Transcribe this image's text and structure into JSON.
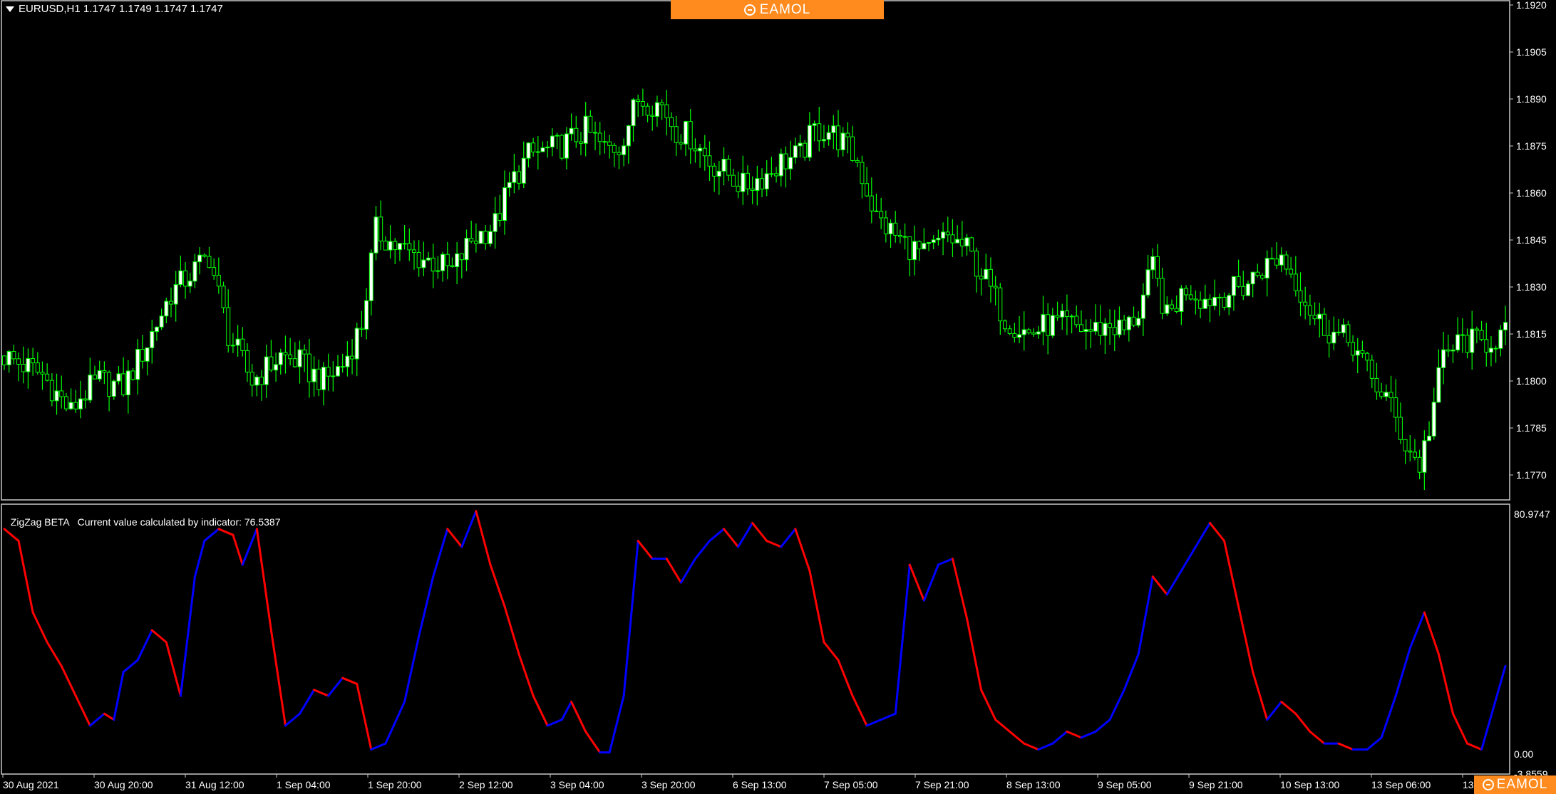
{
  "symbol": {
    "menu_icon": "triangle-down-icon",
    "label": "EURUSD,H1  1.1747 1.1749 1.1747 1.1747"
  },
  "brand": {
    "logo_icon": "eamol-logo-icon",
    "name": "EAMOL"
  },
  "colors": {
    "background": "#000000",
    "grid_border": "#c8c8c8",
    "candle": "#00ff00",
    "candle_body_up": "#ffffff",
    "zigzag_up": "#0000ff",
    "zigzag_down": "#ff0000",
    "brand": "#ff8a1e"
  },
  "price_axis": {
    "labels": [
      "1.1920",
      "1.1905",
      "1.1890",
      "1.1875",
      "1.1860",
      "1.1845",
      "1.1830",
      "1.1815",
      "1.1800",
      "1.1785",
      "1.1770"
    ]
  },
  "indicator": {
    "label": "ZigZag BETA   Current value calculated by indicator: 76.5387",
    "axis_labels": {
      "max": "80.9747",
      "zero": "0.00",
      "min": "-3.8559"
    }
  },
  "time_axis": {
    "labels": [
      "30 Aug 2021",
      "30 Aug 20:00",
      "31 Aug 12:00",
      "1 Sep 04:00",
      "1 Sep 20:00",
      "2 Sep 12:00",
      "3 Sep 04:00",
      "3 Sep 20:00",
      "6 Sep 13:00",
      "7 Sep 05:00",
      "7 Sep 21:00",
      "8 Sep 13:00",
      "9 Sep 05:00",
      "9 Sep 21:00",
      "10 Sep 13:00",
      "13 Sep 06:00",
      "13 Sep 22:00"
    ]
  },
  "chart_data": {
    "type": "candlestick",
    "symbol": "EURUSD",
    "timeframe": "H1",
    "ylim": [
      1.1765,
      1.192
    ],
    "close_path": [
      [
        0,
        1.1808
      ],
      [
        8,
        1.1802
      ],
      [
        14,
        1.179
      ],
      [
        16,
        1.1795
      ],
      [
        20,
        1.18
      ],
      [
        25,
        1.1798
      ],
      [
        30,
        1.1812
      ],
      [
        35,
        1.1828
      ],
      [
        43,
        1.184
      ],
      [
        47,
        1.1815
      ],
      [
        52,
        1.18
      ],
      [
        58,
        1.1808
      ],
      [
        62,
        1.1806
      ],
      [
        64,
        1.1803
      ],
      [
        67,
        1.18
      ],
      [
        71,
        1.1805
      ],
      [
        75,
        1.1818
      ],
      [
        78,
        1.1848
      ],
      [
        82,
        1.1843
      ],
      [
        86,
        1.184
      ],
      [
        90,
        1.1838
      ],
      [
        94,
        1.1835
      ],
      [
        98,
        1.1845
      ],
      [
        103,
        1.185
      ],
      [
        106,
        1.1862
      ],
      [
        110,
        1.1872
      ],
      [
        115,
        1.1874
      ],
      [
        118,
        1.1876
      ],
      [
        122,
        1.188
      ],
      [
        126,
        1.1874
      ],
      [
        129,
        1.1875
      ],
      [
        133,
        1.189
      ],
      [
        138,
        1.1888
      ],
      [
        141,
        1.188
      ],
      [
        144,
        1.1878
      ],
      [
        148,
        1.187
      ],
      [
        152,
        1.1866
      ],
      [
        155,
        1.1862
      ],
      [
        160,
        1.1866
      ],
      [
        163,
        1.187
      ],
      [
        167,
        1.1872
      ],
      [
        170,
        1.188
      ],
      [
        173,
        1.188
      ],
      [
        176,
        1.1876
      ],
      [
        179,
        1.187
      ],
      [
        183,
        1.1852
      ],
      [
        188,
        1.1845
      ],
      [
        193,
        1.184
      ],
      [
        198,
        1.1846
      ],
      [
        202,
        1.1842
      ],
      [
        206,
        1.1832
      ],
      [
        210,
        1.182
      ],
      [
        215,
        1.1815
      ],
      [
        219,
        1.1818
      ],
      [
        223,
        1.1818
      ],
      [
        228,
        1.1816
      ],
      [
        232,
        1.1818
      ],
      [
        235,
        1.1816
      ],
      [
        238,
        1.1822
      ],
      [
        241,
        1.1836
      ],
      [
        244,
        1.182
      ],
      [
        248,
        1.183
      ],
      [
        252,
        1.1826
      ],
      [
        256,
        1.1828
      ],
      [
        260,
        1.183
      ],
      [
        264,
        1.1836
      ],
      [
        268,
        1.184
      ],
      [
        271,
        1.1832
      ],
      [
        275,
        1.182
      ],
      [
        279,
        1.1815
      ],
      [
        283,
        1.1812
      ],
      [
        287,
        1.18
      ],
      [
        290,
        1.1795
      ],
      [
        294,
        1.178
      ],
      [
        297,
        1.1773
      ],
      [
        299,
        1.1785
      ],
      [
        302,
        1.1808
      ],
      [
        306,
        1.1813
      ],
      [
        310,
        1.1812
      ],
      [
        315,
        1.1815
      ]
    ],
    "zigzag_path": [
      [
        0,
        76
      ],
      [
        3,
        72
      ],
      [
        6,
        48
      ],
      [
        9,
        38
      ],
      [
        12,
        30
      ],
      [
        15,
        20
      ],
      [
        18,
        10
      ],
      [
        21,
        14
      ],
      [
        23,
        12
      ],
      [
        25,
        28
      ],
      [
        28,
        32
      ],
      [
        31,
        42
      ],
      [
        34,
        38
      ],
      [
        37,
        20
      ],
      [
        40,
        60
      ],
      [
        42,
        72
      ],
      [
        45,
        76
      ],
      [
        48,
        74
      ],
      [
        50,
        64
      ],
      [
        53,
        76
      ],
      [
        56,
        42
      ],
      [
        59,
        10
      ],
      [
        62,
        14
      ],
      [
        65,
        22
      ],
      [
        68,
        20
      ],
      [
        71,
        26
      ],
      [
        74,
        24
      ],
      [
        77,
        2
      ],
      [
        80,
        4
      ],
      [
        84,
        18
      ],
      [
        87,
        40
      ],
      [
        90,
        60
      ],
      [
        93,
        76
      ],
      [
        96,
        70
      ],
      [
        99,
        82
      ],
      [
        102,
        64
      ],
      [
        105,
        50
      ],
      [
        108,
        34
      ],
      [
        111,
        20
      ],
      [
        114,
        10
      ],
      [
        117,
        12
      ],
      [
        119,
        18
      ],
      [
        122,
        8
      ],
      [
        125,
        1
      ],
      [
        127,
        1
      ],
      [
        130,
        20
      ],
      [
        133,
        72
      ],
      [
        136,
        66
      ],
      [
        139,
        66
      ],
      [
        142,
        58
      ],
      [
        145,
        66
      ],
      [
        148,
        72
      ],
      [
        151,
        76
      ],
      [
        154,
        70
      ],
      [
        157,
        78
      ],
      [
        160,
        72
      ],
      [
        163,
        70
      ],
      [
        166,
        76
      ],
      [
        169,
        62
      ],
      [
        172,
        38
      ],
      [
        175,
        32
      ],
      [
        178,
        20
      ],
      [
        181,
        10
      ],
      [
        184,
        12
      ],
      [
        187,
        14
      ],
      [
        190,
        64
      ],
      [
        193,
        52
      ],
      [
        196,
        64
      ],
      [
        199,
        66
      ],
      [
        202,
        46
      ],
      [
        205,
        22
      ],
      [
        208,
        12
      ],
      [
        211,
        8
      ],
      [
        214,
        4
      ],
      [
        217,
        2
      ],
      [
        220,
        4
      ],
      [
        223,
        8
      ],
      [
        226,
        6
      ],
      [
        229,
        8
      ],
      [
        232,
        12
      ],
      [
        235,
        22
      ],
      [
        238,
        34
      ],
      [
        241,
        60
      ],
      [
        244,
        54
      ],
      [
        247,
        62
      ],
      [
        250,
        70
      ],
      [
        253,
        78
      ],
      [
        256,
        72
      ],
      [
        259,
        50
      ],
      [
        262,
        28
      ],
      [
        265,
        12
      ],
      [
        268,
        18
      ],
      [
        271,
        14
      ],
      [
        274,
        8
      ],
      [
        277,
        4
      ],
      [
        280,
        4
      ],
      [
        283,
        2
      ],
      [
        286,
        2
      ],
      [
        289,
        6
      ],
      [
        292,
        20
      ],
      [
        295,
        36
      ],
      [
        298,
        48
      ],
      [
        301,
        34
      ],
      [
        304,
        14
      ],
      [
        307,
        4
      ],
      [
        310,
        2
      ],
      [
        315,
        30
      ]
    ],
    "zigzag_ylim": [
      -3.8559,
      80.9747
    ],
    "current_value": 76.5387
  }
}
